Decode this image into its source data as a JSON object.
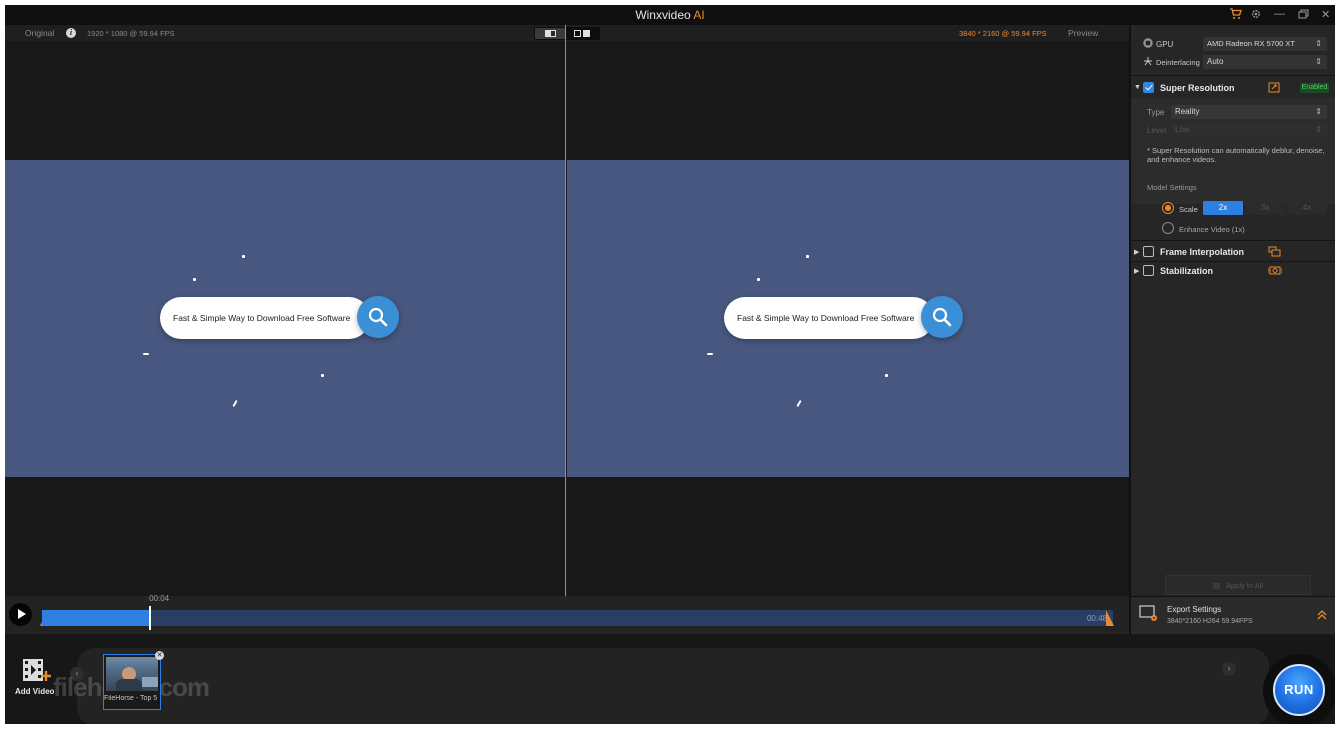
{
  "app": {
    "title_main": "Winxvideo",
    "title_accent": "AI",
    "controls": {
      "minimize": "—",
      "close": "✕"
    }
  },
  "viewbar": {
    "original_label": "Original",
    "original_info": "1920 * 1080 @ 59.94 FPS",
    "output_info": "3840 * 2160 @ 59.94 FPS",
    "preview_label": "Preview",
    "info_glyph": "i"
  },
  "video": {
    "search_text": "Fast & Simple Way to Download Free Software"
  },
  "timeline": {
    "current_time": "00:04",
    "end_time": "00:48",
    "progress": 0.1
  },
  "panel": {
    "gpu_label": "GPU",
    "gpu_value": "AMD Radeon RX 5700 XT",
    "deinterlacing_label": "Deinterlacing",
    "deinterlacing_value": "Auto",
    "super_resolution": {
      "title": "Super Resolution",
      "badge": "Enabled",
      "type_label": "Type",
      "type_value": "Reality",
      "level_label": "Level",
      "level_value": "Low",
      "note": "* Super Resolution can automatically deblur, denoise, and enhance videos.",
      "model_settings_label": "Model Settings",
      "scale_label": "Scale",
      "scale_options": [
        "2x",
        "3x",
        "4x"
      ],
      "enhance_label": "Enhance Video (1x)"
    },
    "frame_interpolation": {
      "title": "Frame Interpolation"
    },
    "stabilization": {
      "title": "Stabilization"
    },
    "apply_all": "Apply to All",
    "export": {
      "title": "Export Settings",
      "details": "3840*2160  H264  59.94FPS"
    }
  },
  "bottom": {
    "add_video_label": "Add Video",
    "thumb_label": "FileHorse - Top 5",
    "watermark": "filehorse.com",
    "run_label": "RUN"
  },
  "colors": {
    "accent_orange": "#e88a2e",
    "accent_blue": "#2d7fe0",
    "frame_bg": "#47577f",
    "enabled_green": "#4fd16a"
  }
}
